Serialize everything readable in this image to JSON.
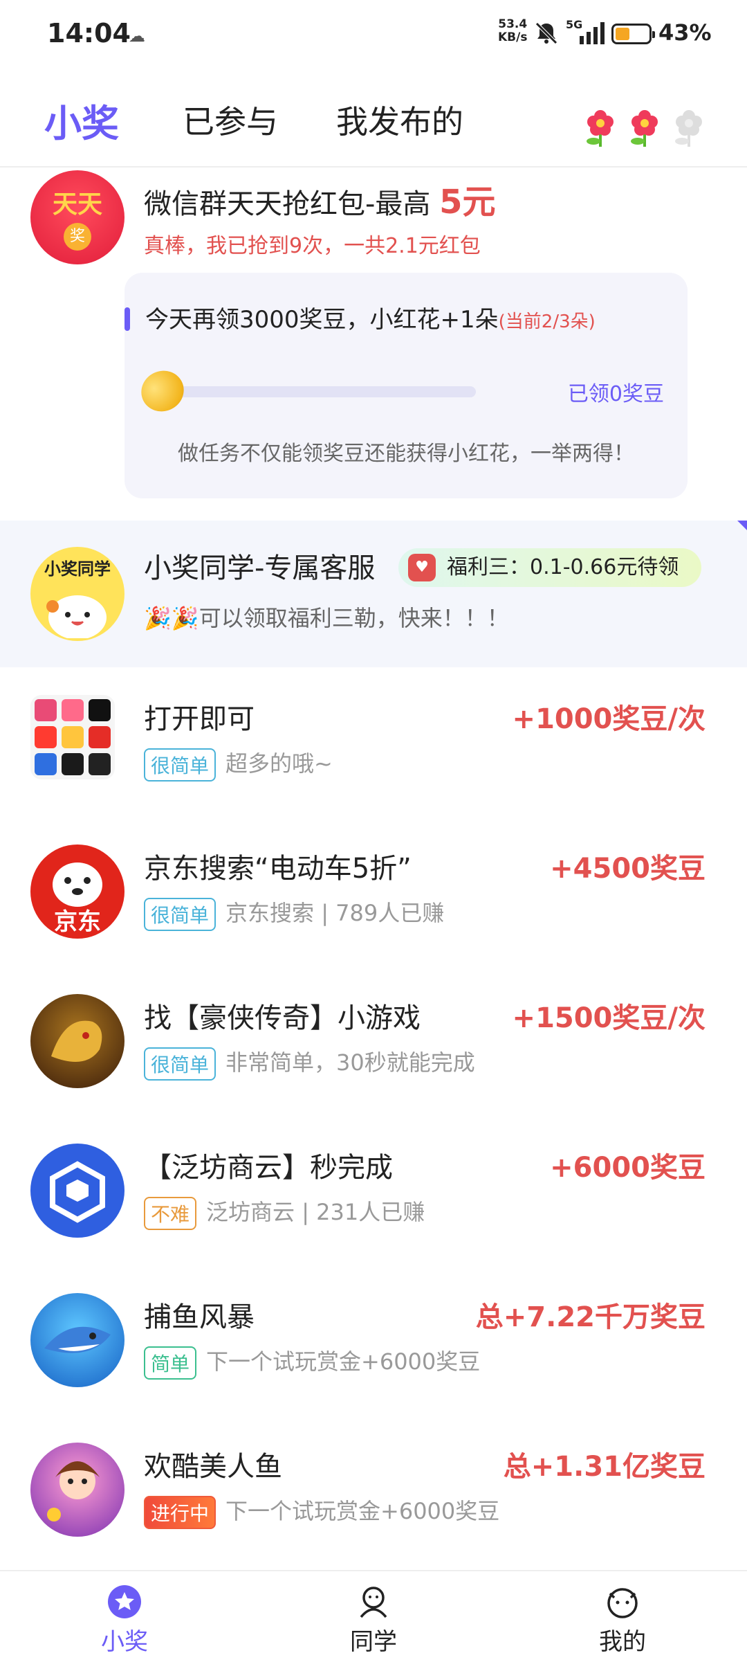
{
  "status_bar": {
    "time": "14:04",
    "net_speed_value": "53.4",
    "net_speed_unit": "KB/s",
    "network": "5G",
    "battery": "43%",
    "battery_level": 0.43
  },
  "tabs": [
    {
      "label": "小奖",
      "active": true
    },
    {
      "label": "已参与",
      "active": false
    },
    {
      "label": "我发布的",
      "active": false
    }
  ],
  "featured": {
    "avatar_text_1": "天天",
    "avatar_text_2": "奖",
    "title": "微信群天天抢红包-最高 ",
    "title_highlight": "5元",
    "subtitle": "真棒，我已抢到9次，一共2.1元红包",
    "task_title": "今天再领3000奖豆，小红花+1朵",
    "task_progress_note": "(当前2/3朵)",
    "task_received": "已领0奖豆",
    "task_progress": 0,
    "task_tip": "做任务不仅能领奖豆还能获得小红花，一举两得！"
  },
  "customer_service": {
    "avatar_text": "小奖同学",
    "title": "小奖同学-专属客服",
    "welfare_label": "福利三：0.1-0.66元待领",
    "subtitle_emoji": "🎉🎉",
    "subtitle": "可以领取福利三勒，快来！！！"
  },
  "list": [
    {
      "title": "打开即可",
      "reward": "+1000奖豆/次",
      "tag": "很简单",
      "tag_color": "#4ab3d9",
      "desc": "超多的哦~",
      "icon": "app-grid-icon"
    },
    {
      "title": "京东搜索“电动车5折”",
      "reward": "+4500奖豆",
      "tag": "很简单",
      "tag_color": "#4ab3d9",
      "desc": "京东搜索 | 789人已赚",
      "icon": "jd-logo",
      "logo_text": "京东"
    },
    {
      "title": "找【豪侠传奇】小游戏",
      "reward": "+1500奖豆/次",
      "tag": "很简单",
      "tag_color": "#4ab3d9",
      "desc": "非常简单，30秒就能完成",
      "icon": "game-dragon-icon"
    },
    {
      "title": "【泛坊商云】秒完成",
      "reward": "+6000奖豆",
      "tag": "不难",
      "tag_color": "#e89a3c",
      "desc": "泛坊商云 | 231人已赚",
      "icon": "cube-logo-icon"
    },
    {
      "title": "捕鱼风暴",
      "reward": "总+7.22千万奖豆",
      "tag": "简单",
      "tag_color": "#3bbf8f",
      "desc": "下一个试玩赏金+6000奖豆",
      "icon": "shark-game-icon"
    },
    {
      "title": "欢酷美人鱼",
      "reward": "总+1.31亿奖豆",
      "tag": "进行中",
      "tag_color": "#f05a3a",
      "desc": "下一个试玩赏金+6000奖豆",
      "icon": "mermaid-game-icon"
    }
  ],
  "bottom_nav": [
    {
      "label": "小奖",
      "active": true,
      "icon": "star-icon"
    },
    {
      "label": "同学",
      "active": false,
      "icon": "buddy-icon"
    },
    {
      "label": "我的",
      "active": false,
      "icon": "face-icon"
    }
  ]
}
